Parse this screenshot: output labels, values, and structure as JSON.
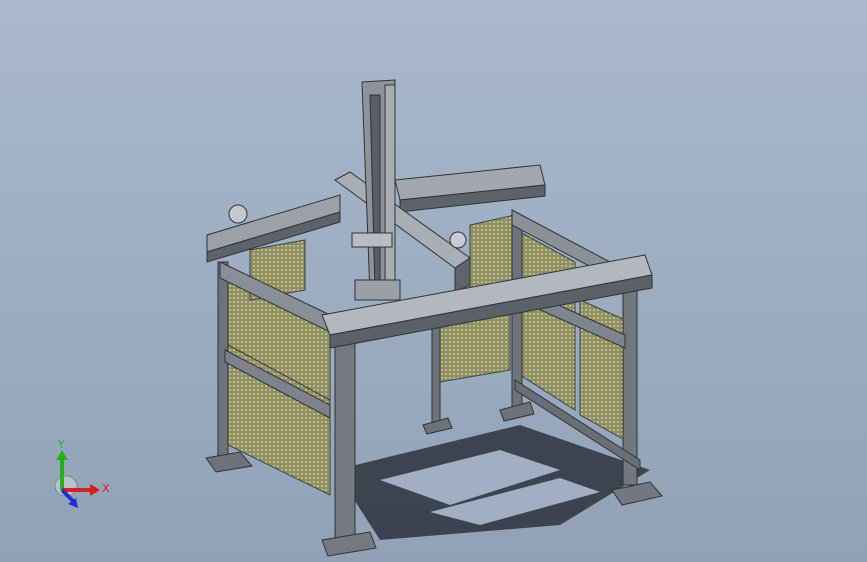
{
  "triad": {
    "x_label": "X",
    "y_label": "Y",
    "x_color": "#d42020",
    "y_color": "#20b020",
    "z_color": "#2030d0"
  },
  "colors": {
    "background": "#9eafc3",
    "steel": "#7a7f87",
    "steel_light": "#b4b9c0",
    "steel_dark": "#3c3f45",
    "mesh": "#e6e07a",
    "shadow": "#2a2f38"
  }
}
